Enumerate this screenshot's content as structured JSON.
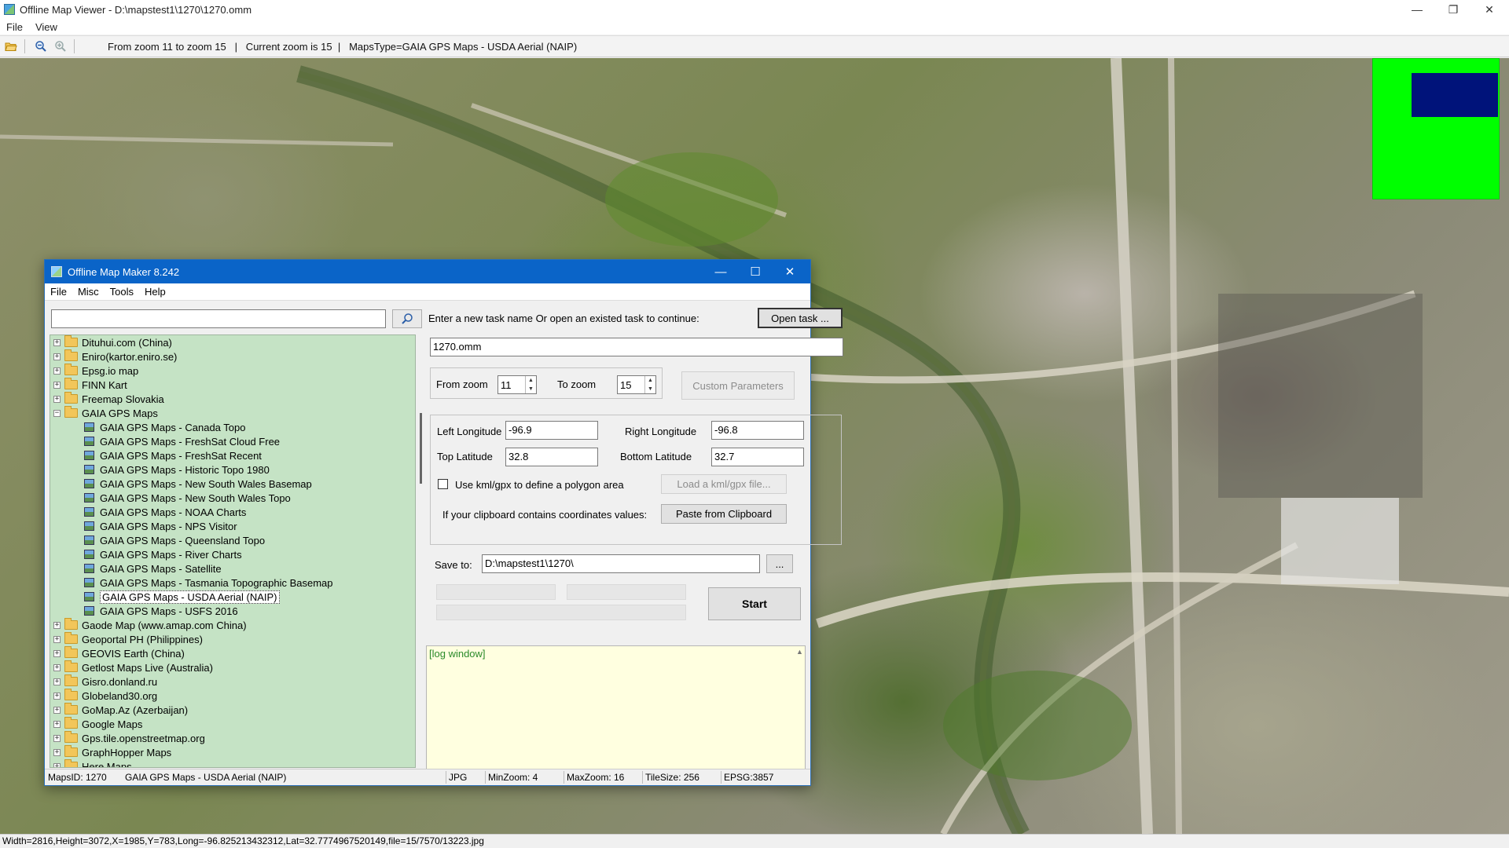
{
  "viewer": {
    "title": "Offline Map Viewer - D:\\mapstest1\\1270\\1270.omm",
    "menu": [
      "File",
      "View"
    ],
    "toolbar_info": "From zoom 11 to zoom 15   |   Current zoom is 15  |   MapsType=GAIA GPS Maps - USDA Aerial (NAIP)",
    "status": "Width=2816,Height=3072,X=1985,Y=783,Long=-96.825213432312,Lat=32.7774967520149,file=15/7570/13223.jpg",
    "window_controls": {
      "minimize": "—",
      "restore": "❐",
      "close": "✕"
    }
  },
  "dialog": {
    "title": "Offline Map Maker 8.242",
    "menu": [
      "File",
      "Misc",
      "Tools",
      "Help"
    ],
    "search": {
      "value": "",
      "placeholder": ""
    },
    "tree": [
      {
        "label": "Dituhui.com (China)",
        "type": "folder",
        "expanded": false
      },
      {
        "label": "Eniro(kartor.eniro.se)",
        "type": "folder",
        "expanded": false
      },
      {
        "label": "Epsg.io map",
        "type": "folder",
        "expanded": false
      },
      {
        "label": "FINN Kart",
        "type": "folder",
        "expanded": false
      },
      {
        "label": "Freemap Slovakia",
        "type": "folder",
        "expanded": false
      },
      {
        "label": "GAIA GPS Maps",
        "type": "folder",
        "expanded": true
      },
      {
        "label": "GAIA GPS Maps - Canada Topo",
        "type": "map"
      },
      {
        "label": "GAIA GPS Maps - FreshSat Cloud Free",
        "type": "map"
      },
      {
        "label": "GAIA GPS Maps - FreshSat Recent",
        "type": "map"
      },
      {
        "label": "GAIA GPS Maps - Historic Topo 1980",
        "type": "map"
      },
      {
        "label": "GAIA GPS Maps - New South Wales Basemap",
        "type": "map"
      },
      {
        "label": "GAIA GPS Maps - New South Wales Topo",
        "type": "map"
      },
      {
        "label": "GAIA GPS Maps - NOAA Charts",
        "type": "map"
      },
      {
        "label": "GAIA GPS Maps - NPS Visitor",
        "type": "map"
      },
      {
        "label": "GAIA GPS Maps - Queensland Topo",
        "type": "map"
      },
      {
        "label": "GAIA GPS Maps - River Charts",
        "type": "map"
      },
      {
        "label": "GAIA GPS Maps - Satellite",
        "type": "map"
      },
      {
        "label": "GAIA GPS Maps - Tasmania Topographic Basemap",
        "type": "map"
      },
      {
        "label": "GAIA GPS Maps - USDA Aerial (NAIP)",
        "type": "map",
        "selected": true
      },
      {
        "label": "GAIA GPS Maps - USFS 2016",
        "type": "map"
      },
      {
        "label": "Gaode Map (www.amap.com China)",
        "type": "folder",
        "expanded": false
      },
      {
        "label": "Geoportal PH (Philippines)",
        "type": "folder",
        "expanded": false
      },
      {
        "label": "GEOVIS Earth (China)",
        "type": "folder",
        "expanded": false
      },
      {
        "label": "Getlost Maps Live (Australia)",
        "type": "folder",
        "expanded": false
      },
      {
        "label": "Gisro.donland.ru",
        "type": "folder",
        "expanded": false
      },
      {
        "label": "Globeland30.org",
        "type": "folder",
        "expanded": false
      },
      {
        "label": "GoMap.Az (Azerbaijan)",
        "type": "folder",
        "expanded": false
      },
      {
        "label": "Google Maps",
        "type": "folder",
        "expanded": false
      },
      {
        "label": "Gps.tile.openstreetmap.org",
        "type": "folder",
        "expanded": false
      },
      {
        "label": "GraphHopper Maps",
        "type": "folder",
        "expanded": false
      },
      {
        "label": "Here Maps",
        "type": "folder",
        "expanded": false
      }
    ],
    "task_prompt": "Enter a new task name Or open an existed task to continue:",
    "open_task_label": "Open task ...",
    "task_name": "1270.omm",
    "from_zoom_label": "From zoom",
    "from_zoom": "11",
    "to_zoom_label": "To zoom",
    "to_zoom": "15",
    "custom_params_label": "Custom Parameters",
    "left_lon_label": "Left Longitude",
    "left_lon": "-96.9",
    "right_lon_label": "Right Longitude",
    "right_lon": "-96.8",
    "top_lat_label": "Top Latitude",
    "top_lat": "32.8",
    "bottom_lat_label": "Bottom Latitude",
    "bottom_lat": "32.7",
    "kml_label": "Use kml/gpx to define a polygon area",
    "load_kml_label": "Load a kml/gpx file...",
    "clipboard_prompt": "If your clipboard contains coordinates values:",
    "paste_label": "Paste from Clipboard",
    "save_to_label": "Save to:",
    "save_to": "D:\\mapstest1\\1270\\",
    "browse_label": "...",
    "start_label": "Start",
    "log_text": "[log window]",
    "status": {
      "maps_id": "MapsID: 1270",
      "map_name": "GAIA GPS Maps - USDA Aerial (NAIP)",
      "format": "JPG",
      "min_zoom": "MinZoom: 4",
      "max_zoom": "MaxZoom: 16",
      "tile_size": "TileSize: 256",
      "epsg": "EPSG:3857"
    }
  },
  "colors": {
    "dialog_title_bg": "#0a64c8",
    "tree_bg": "#c5e3c5",
    "log_bg": "#ffffe0",
    "minimap_bg": "#00ff00",
    "minimap_viewport": "#00137a"
  }
}
